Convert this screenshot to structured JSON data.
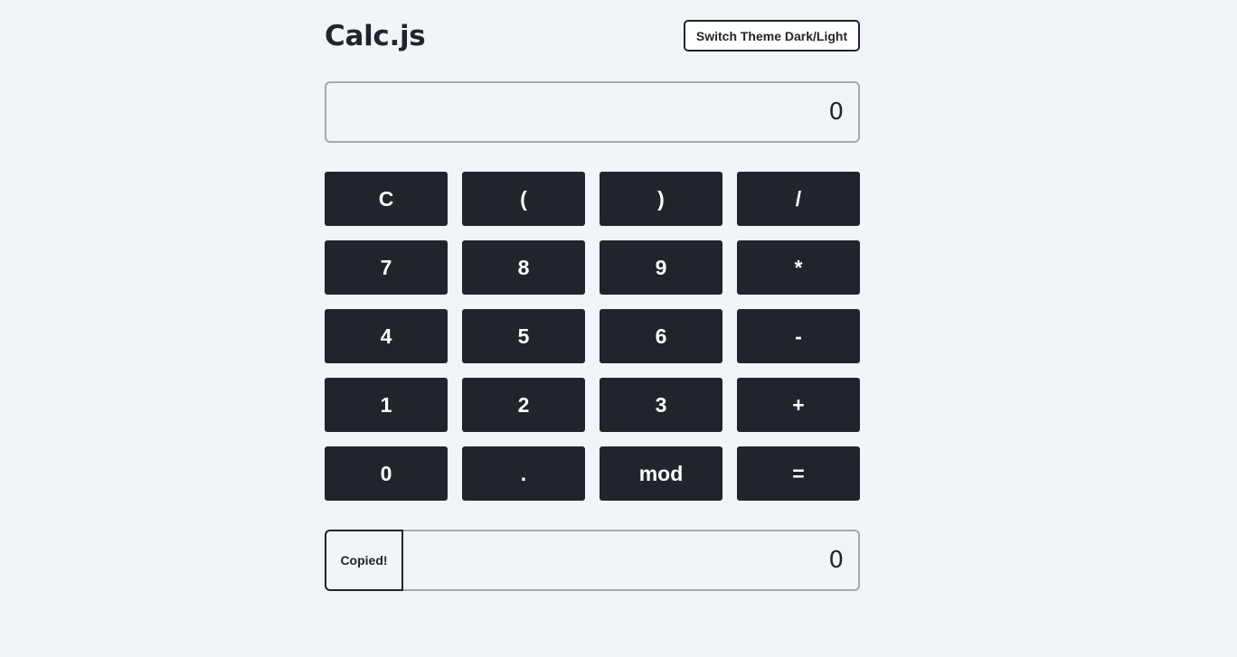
{
  "header": {
    "title": "Calc.js",
    "theme_button_label": "Switch Theme Dark/Light"
  },
  "display": {
    "value": "0"
  },
  "keypad": {
    "keys": [
      "C",
      "(",
      ")",
      "/",
      "7",
      "8",
      "9",
      "*",
      "4",
      "5",
      "6",
      "-",
      "1",
      "2",
      "3",
      "+",
      "0",
      ".",
      "mod",
      "="
    ]
  },
  "result": {
    "copy_label": "Copied!",
    "value": "0"
  },
  "colors": {
    "background": "#f1f4f8",
    "key_background": "#21252b",
    "key_text": "#ffffff",
    "border": "#a5aab0"
  }
}
